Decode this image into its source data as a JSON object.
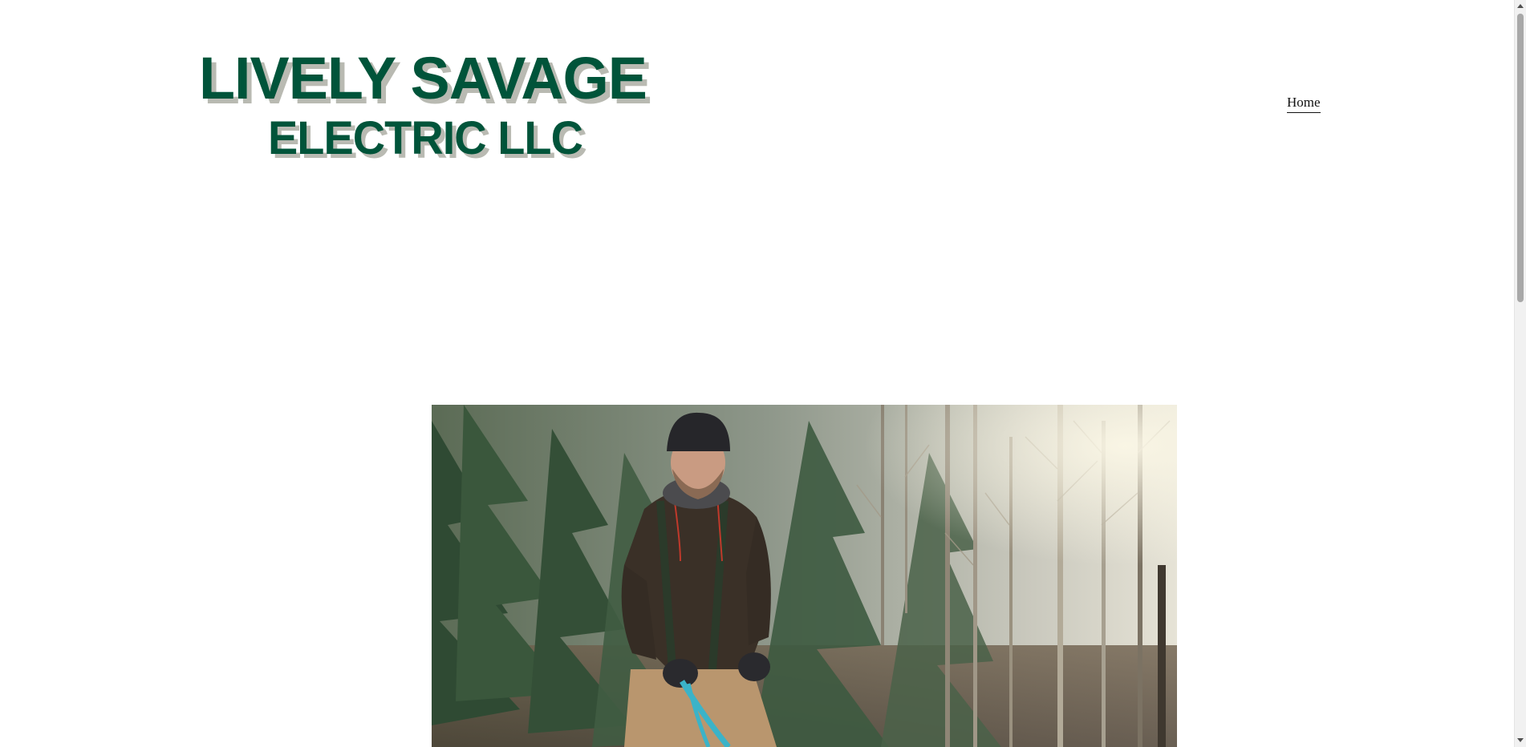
{
  "header": {
    "logo": {
      "line1": "LIVELY  SAVAGE",
      "line2": "ELECTRIC  LLC",
      "text_color": "#00543a",
      "shadow_color": "#b9bab2"
    }
  },
  "nav": {
    "items": [
      {
        "label": "Home",
        "active": true
      }
    ]
  },
  "hero": {
    "image_icon": "photo-icon"
  },
  "colors": {
    "background": "#ffffff",
    "nav_text": "#111111"
  }
}
